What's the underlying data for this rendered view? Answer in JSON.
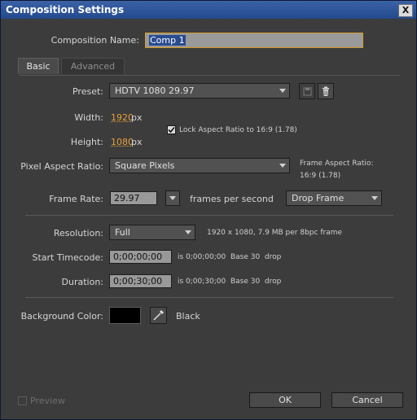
{
  "window": {
    "title": "Composition Settings",
    "close_glyph": "X"
  },
  "comp_name": {
    "label": "Composition Name:",
    "value": "Comp 1"
  },
  "tabs": [
    {
      "label": "Basic"
    },
    {
      "label": "Advanced"
    }
  ],
  "preset": {
    "label": "Preset:",
    "value": "HDTV 1080 29.97"
  },
  "width": {
    "label": "Width:",
    "value": "1920",
    "unit": "px"
  },
  "height": {
    "label": "Height:",
    "value": "1080",
    "unit": "px"
  },
  "lock_aspect": {
    "label": "Lock Aspect Ratio to 16:9 (1.78)",
    "checked": true
  },
  "pixel_aspect": {
    "label": "Pixel Aspect Ratio:",
    "value": "Square Pixels"
  },
  "frame_aspect": {
    "label": "Frame Aspect Ratio:",
    "value": "16:9 (1.78)"
  },
  "frame_rate": {
    "label": "Frame Rate:",
    "value": "29.97",
    "unit": "frames per second",
    "mode": "Drop Frame"
  },
  "resolution": {
    "label": "Resolution:",
    "value": "Full",
    "info": "1920 x 1080, 7.9 MB per 8bpc frame"
  },
  "start_timecode": {
    "label": "Start Timecode:",
    "value": "0;00;00;00",
    "info": "is 0;00;00;00  Base 30  drop"
  },
  "duration": {
    "label": "Duration:",
    "value": "0;00;30;00",
    "info": "is 0;00;30;00  Base 30  drop"
  },
  "background": {
    "label": "Background Color:",
    "color": "#000000",
    "name": "Black"
  },
  "footer": {
    "preview_label": "Preview",
    "ok_label": "OK",
    "cancel_label": "Cancel"
  },
  "icons": {
    "save_preset": "save-icon",
    "delete_preset": "trash-icon",
    "eyedropper": "eyedropper-icon"
  }
}
